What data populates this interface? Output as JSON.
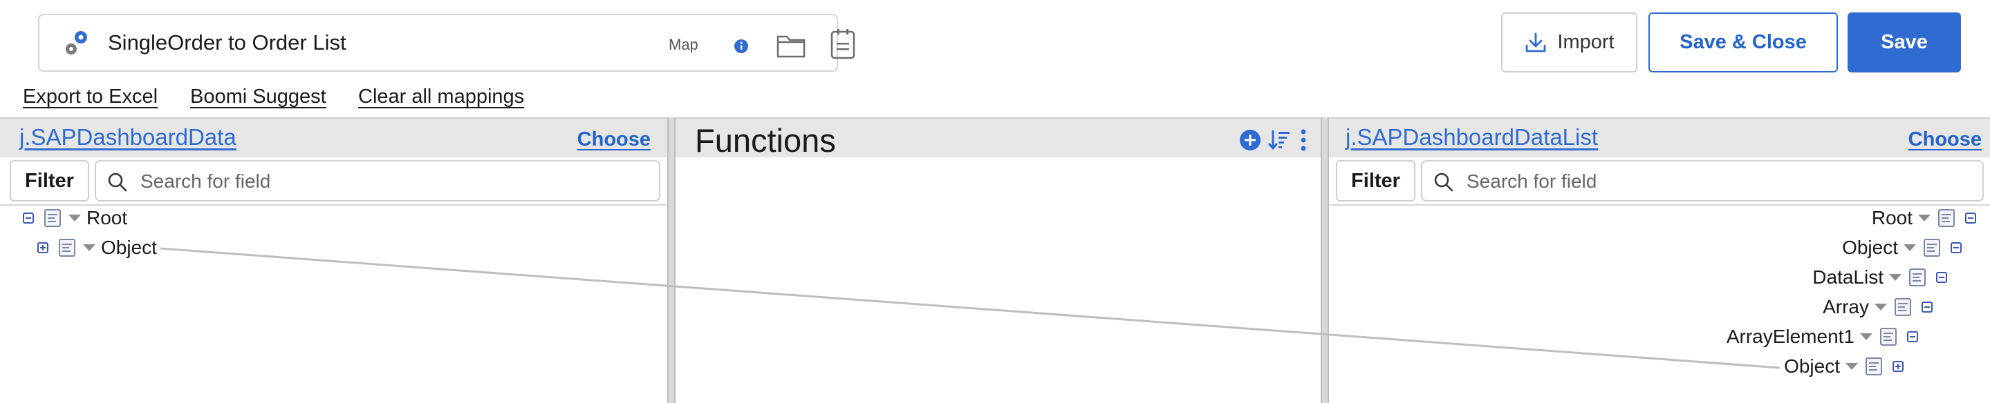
{
  "header": {
    "map_name": "SingleOrder to Order List",
    "map_label": "Map",
    "import_label": "Import",
    "save_close_label": "Save & Close",
    "save_label": "Save"
  },
  "actions": {
    "export": "Export to Excel",
    "suggest": "Boomi Suggest",
    "clear": "Clear all mappings"
  },
  "source": {
    "profile": "j.SAPDashboardData",
    "choose": "Choose",
    "filter": "Filter",
    "search_placeholder": "Search for field",
    "nodes": [
      "Root",
      "Object"
    ]
  },
  "functions": {
    "title": "Functions"
  },
  "destination": {
    "profile": "j.SAPDashboardDataList",
    "choose": "Choose",
    "filter": "Filter",
    "search_placeholder": "Search for field",
    "nodes": [
      "Root",
      "Object",
      "DataList",
      "Array",
      "ArrayElement1",
      "Object"
    ]
  },
  "colors": {
    "accent": "#2f6bd0",
    "panel_header": "#e6e6e6",
    "expander": "#3a57b5"
  },
  "icons": {
    "map_icon": "gears-icon",
    "info": "info-icon",
    "folder": "folder-icon",
    "notes": "clipboard-icon",
    "import": "download-icon",
    "search": "search-icon",
    "add_function": "plus-circle-icon",
    "sort": "sort-icon",
    "more": "kebab-icon"
  }
}
